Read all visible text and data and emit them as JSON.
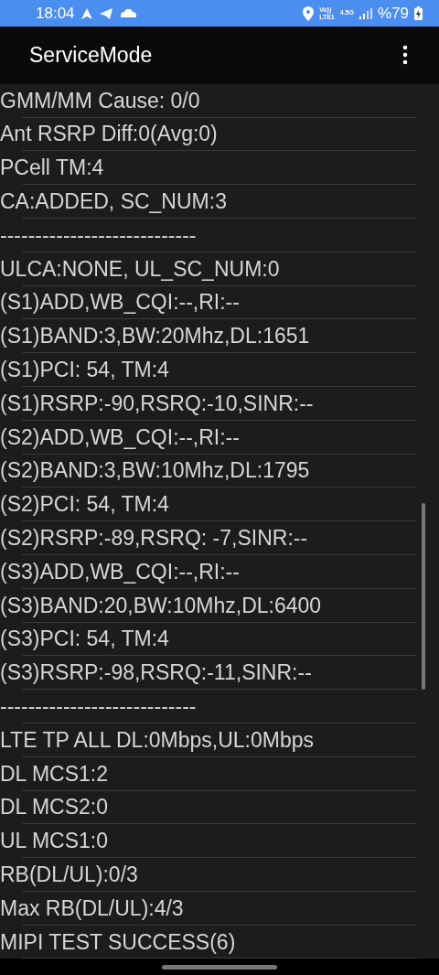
{
  "status_bar": {
    "time": "18:04",
    "volte": "Vo))",
    "lte": "LTE1",
    "network": "4.5G",
    "battery": "%79"
  },
  "app_bar": {
    "title": "ServiceMode"
  },
  "lines": [
    "GMM/MM Cause: 0/0",
    "Ant RSRP Diff:0(Avg:0)",
    "PCell TM:4",
    "CA:ADDED, SC_NUM:3",
    "----------------------------",
    "ULCA:NONE, UL_SC_NUM:0",
    "(S1)ADD,WB_CQI:--,RI:--",
    "(S1)BAND:3,BW:20Mhz,DL:1651",
    "(S1)PCI: 54, TM:4",
    "(S1)RSRP:-90,RSRQ:-10,SINR:--",
    "(S2)ADD,WB_CQI:--,RI:--",
    "(S2)BAND:3,BW:10Mhz,DL:1795",
    "(S2)PCI: 54, TM:4",
    "(S2)RSRP:-89,RSRQ: -7,SINR:--",
    "(S3)ADD,WB_CQI:--,RI:--",
    "(S3)BAND:20,BW:10Mhz,DL:6400",
    "(S3)PCI: 54, TM:4",
    "(S3)RSRP:-98,RSRQ:-11,SINR:--",
    "----------------------------",
    "LTE TP ALL DL:0Mbps,UL:0Mbps",
    "DL MCS1:2",
    "DL MCS2:0",
    "UL MCS1:0",
    "RB(DL/UL):0/3",
    "Max RB(DL/UL):4/3",
    "MIPI TEST SUCCESS(6)"
  ]
}
